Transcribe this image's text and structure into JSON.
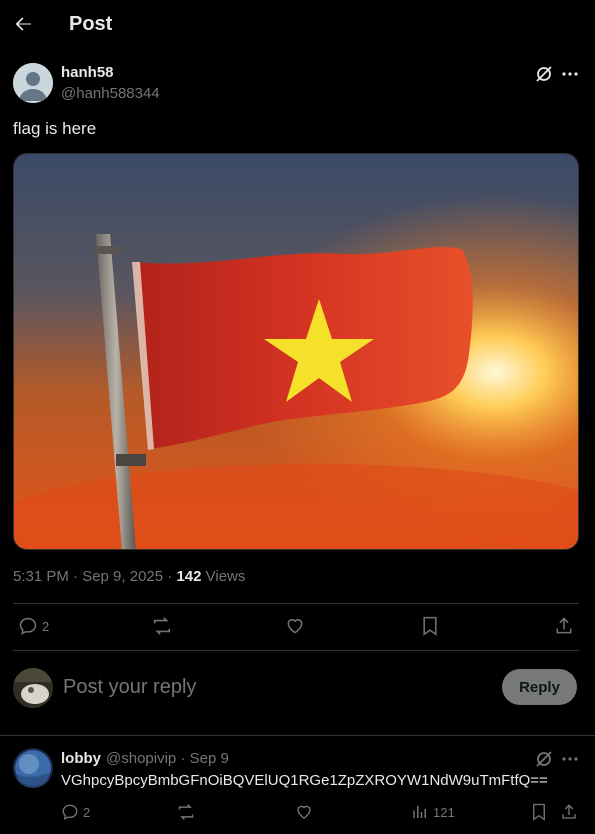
{
  "header": {
    "title": "Post"
  },
  "post": {
    "display_name": "hanh58",
    "handle": "@hanh588344",
    "text": "flag is here",
    "time": "5:31 PM · Sep 9, 2025 · ",
    "views_count": "142",
    "views_label": " Views",
    "replies": "2"
  },
  "reply_box": {
    "placeholder": "Post your reply",
    "button_label": "Reply"
  },
  "comment": {
    "display_name": "lobby",
    "handle_date": "@shopivip · Sep 9",
    "text": "VGhpcyBpcyBmbGFnOiBQVElUQ1RGe1ZpZXROYW1NdW9uTmFtfQ==",
    "replies": "2",
    "views": "121"
  }
}
